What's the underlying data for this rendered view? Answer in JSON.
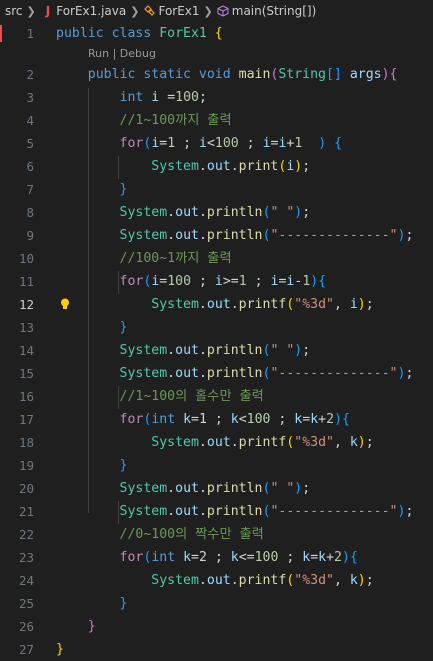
{
  "breadcrumb": {
    "items": [
      "src",
      "ForEx1.java",
      "ForEx1",
      "main(String[])"
    ],
    "java_icon": "J"
  },
  "codelens": "Run | Debug",
  "icons": {
    "chevron": "chevron-right-icon",
    "java_file": "java-file-icon",
    "class": "class-icon",
    "method": "method-icon",
    "lightbulb": "lightbulb-icon"
  },
  "colors": {
    "background": "#1f1f1f",
    "keyword": "#569cd6",
    "control": "#c586c0",
    "type": "#4ec9b0",
    "variable": "#9cdcfe",
    "function": "#dcdcaa",
    "number": "#b5cea8",
    "string": "#ce9178",
    "comment": "#6a9955",
    "bracket_gold": "#ffd700",
    "bracket_pink": "#da70d6",
    "bracket_blue": "#179fff"
  },
  "current_line": 12,
  "lines": [
    {
      "n": "1",
      "t": [
        [
          "kw",
          "public "
        ],
        [
          "kw",
          "class "
        ],
        [
          "type",
          "ForEx1 "
        ],
        [
          "br1",
          "{"
        ]
      ]
    },
    {
      "n": "2",
      "t": [
        [
          "",
          "    "
        ],
        [
          "kw",
          "public "
        ],
        [
          "kw",
          "static "
        ],
        [
          "kw",
          "void "
        ],
        [
          "fn",
          "main"
        ],
        [
          "br2",
          "("
        ],
        [
          "type",
          "String"
        ],
        [
          "br3",
          "[]"
        ],
        [
          "var",
          " args"
        ],
        [
          "br2",
          ")"
        ],
        [
          "br2",
          "{"
        ]
      ]
    },
    {
      "n": "3",
      "t": [
        [
          "",
          "        "
        ],
        [
          "kw",
          "int "
        ],
        [
          "var",
          "i"
        ],
        [
          "",
          " ="
        ],
        [
          "num",
          "100"
        ],
        [
          "",
          ";"
        ]
      ]
    },
    {
      "n": "4",
      "t": [
        [
          "",
          "        "
        ],
        [
          "cmt",
          "//1~100까지 출력"
        ]
      ]
    },
    {
      "n": "5",
      "t": [
        [
          "",
          "        "
        ],
        [
          "ctl",
          "for"
        ],
        [
          "br3",
          "("
        ],
        [
          "var",
          "i"
        ],
        [
          "",
          "="
        ],
        [
          "num",
          "1"
        ],
        [
          "",
          " ; "
        ],
        [
          "var",
          "i"
        ],
        [
          "",
          "<"
        ],
        [
          "num",
          "100"
        ],
        [
          "",
          " ; "
        ],
        [
          "var",
          "i"
        ],
        [
          "",
          "="
        ],
        [
          "var",
          "i"
        ],
        [
          "",
          "+"
        ],
        [
          "num",
          "1"
        ],
        [
          "",
          "  "
        ],
        [
          "br3",
          ")"
        ],
        [
          "",
          " "
        ],
        [
          "br3",
          "{"
        ]
      ]
    },
    {
      "n": "6",
      "t": [
        [
          "",
          "            "
        ],
        [
          "type",
          "System"
        ],
        [
          "",
          "."
        ],
        [
          "var",
          "out"
        ],
        [
          "",
          "."
        ],
        [
          "fn",
          "print"
        ],
        [
          "br1",
          "("
        ],
        [
          "var",
          "i"
        ],
        [
          "br1",
          ")"
        ],
        [
          "",
          ";"
        ]
      ]
    },
    {
      "n": "7",
      "t": [
        [
          "",
          "        "
        ],
        [
          "br3",
          "}"
        ]
      ]
    },
    {
      "n": "8",
      "t": [
        [
          "",
          "        "
        ],
        [
          "type",
          "System"
        ],
        [
          "",
          "."
        ],
        [
          "var",
          "out"
        ],
        [
          "",
          "."
        ],
        [
          "fn",
          "println"
        ],
        [
          "br3",
          "("
        ],
        [
          "str",
          "\" \""
        ],
        [
          "br3",
          ")"
        ],
        [
          "",
          ";"
        ]
      ]
    },
    {
      "n": "9",
      "t": [
        [
          "",
          "        "
        ],
        [
          "type",
          "System"
        ],
        [
          "",
          "."
        ],
        [
          "var",
          "out"
        ],
        [
          "",
          "."
        ],
        [
          "fn",
          "println"
        ],
        [
          "br3",
          "("
        ],
        [
          "str",
          "\"--------------\""
        ],
        [
          "br3",
          ")"
        ],
        [
          "",
          ";"
        ]
      ]
    },
    {
      "n": "10",
      "t": [
        [
          "",
          "        "
        ],
        [
          "cmt",
          "//100~1까지 출력"
        ]
      ]
    },
    {
      "n": "11",
      "t": [
        [
          "",
          "        "
        ],
        [
          "ctl",
          "for"
        ],
        [
          "br3",
          "("
        ],
        [
          "var",
          "i"
        ],
        [
          "",
          "="
        ],
        [
          "num",
          "100"
        ],
        [
          "",
          " ; "
        ],
        [
          "var",
          "i"
        ],
        [
          "",
          ">="
        ],
        [
          "num",
          "1"
        ],
        [
          "",
          " ; "
        ],
        [
          "var",
          "i"
        ],
        [
          "",
          "="
        ],
        [
          "var",
          "i"
        ],
        [
          "",
          "-"
        ],
        [
          "num",
          "1"
        ],
        [
          "br3",
          ")"
        ],
        [
          "br3",
          "{"
        ]
      ]
    },
    {
      "n": "12",
      "t": [
        [
          "",
          "            "
        ],
        [
          "type",
          "System"
        ],
        [
          "",
          "."
        ],
        [
          "var",
          "out"
        ],
        [
          "",
          "."
        ],
        [
          "fn",
          "printf"
        ],
        [
          "br1",
          "("
        ],
        [
          "str",
          "\"%3d\""
        ],
        [
          "",
          ", "
        ],
        [
          "var",
          "i"
        ],
        [
          "br1",
          ")"
        ],
        [
          "",
          ";"
        ]
      ]
    },
    {
      "n": "13",
      "t": [
        [
          "",
          "        "
        ],
        [
          "br3",
          "}"
        ]
      ]
    },
    {
      "n": "14",
      "t": [
        [
          "",
          "        "
        ],
        [
          "type",
          "System"
        ],
        [
          "",
          "."
        ],
        [
          "var",
          "out"
        ],
        [
          "",
          "."
        ],
        [
          "fn",
          "println"
        ],
        [
          "br3",
          "("
        ],
        [
          "str",
          "\" \""
        ],
        [
          "br3",
          ")"
        ],
        [
          "",
          ";"
        ]
      ]
    },
    {
      "n": "15",
      "t": [
        [
          "",
          "        "
        ],
        [
          "type",
          "System"
        ],
        [
          "",
          "."
        ],
        [
          "var",
          "out"
        ],
        [
          "",
          "."
        ],
        [
          "fn",
          "println"
        ],
        [
          "br3",
          "("
        ],
        [
          "str",
          "\"--------------\""
        ],
        [
          "br3",
          ")"
        ],
        [
          "",
          ";"
        ]
      ]
    },
    {
      "n": "16",
      "t": [
        [
          "",
          "        "
        ],
        [
          "cmt",
          "//1~100의 홀수만 출력"
        ]
      ]
    },
    {
      "n": "17",
      "t": [
        [
          "",
          "        "
        ],
        [
          "ctl",
          "for"
        ],
        [
          "br3",
          "("
        ],
        [
          "kw",
          "int "
        ],
        [
          "var",
          "k"
        ],
        [
          "",
          "=1 ; "
        ],
        [
          "var",
          "k"
        ],
        [
          "",
          "<"
        ],
        [
          "num",
          "100"
        ],
        [
          "",
          " ; "
        ],
        [
          "var",
          "k"
        ],
        [
          "",
          "="
        ],
        [
          "var",
          "k"
        ],
        [
          "",
          "+"
        ],
        [
          "num",
          "2"
        ],
        [
          "br3",
          ")"
        ],
        [
          "br3",
          "{"
        ]
      ]
    },
    {
      "n": "18",
      "t": [
        [
          "",
          "            "
        ],
        [
          "type",
          "System"
        ],
        [
          "",
          "."
        ],
        [
          "var",
          "out"
        ],
        [
          "",
          "."
        ],
        [
          "fn",
          "printf"
        ],
        [
          "br1",
          "("
        ],
        [
          "str",
          "\"%3d\""
        ],
        [
          "",
          ", "
        ],
        [
          "var",
          "k"
        ],
        [
          "br1",
          ")"
        ],
        [
          "",
          ";"
        ]
      ]
    },
    {
      "n": "19",
      "t": [
        [
          "",
          "        "
        ],
        [
          "br3",
          "}"
        ]
      ]
    },
    {
      "n": "20",
      "t": [
        [
          "",
          "        "
        ],
        [
          "type",
          "System"
        ],
        [
          "",
          "."
        ],
        [
          "var",
          "out"
        ],
        [
          "",
          "."
        ],
        [
          "fn",
          "println"
        ],
        [
          "br3",
          "("
        ],
        [
          "str",
          "\" \""
        ],
        [
          "br3",
          ")"
        ],
        [
          "",
          ";"
        ]
      ]
    },
    {
      "n": "21",
      "t": [
        [
          "",
          "        "
        ],
        [
          "type",
          "System"
        ],
        [
          "",
          "."
        ],
        [
          "var",
          "out"
        ],
        [
          "",
          "."
        ],
        [
          "fn",
          "println"
        ],
        [
          "br3",
          "("
        ],
        [
          "str",
          "\"--------------\""
        ],
        [
          "br3",
          ")"
        ],
        [
          "",
          ";"
        ]
      ]
    },
    {
      "n": "22",
      "t": [
        [
          "",
          "        "
        ],
        [
          "cmt",
          "//0~100의 짝수만 출력"
        ]
      ]
    },
    {
      "n": "23",
      "t": [
        [
          "",
          "        "
        ],
        [
          "ctl",
          "for"
        ],
        [
          "br3",
          "("
        ],
        [
          "kw",
          "int "
        ],
        [
          "var",
          "k"
        ],
        [
          "",
          "=2 ; "
        ],
        [
          "var",
          "k"
        ],
        [
          "",
          "<="
        ],
        [
          "num",
          "100"
        ],
        [
          "",
          " ; "
        ],
        [
          "var",
          "k"
        ],
        [
          "",
          "="
        ],
        [
          "var",
          "k"
        ],
        [
          "",
          "+"
        ],
        [
          "num",
          "2"
        ],
        [
          "br3",
          ")"
        ],
        [
          "br3",
          "{"
        ]
      ]
    },
    {
      "n": "24",
      "t": [
        [
          "",
          "            "
        ],
        [
          "type",
          "System"
        ],
        [
          "",
          "."
        ],
        [
          "var",
          "out"
        ],
        [
          "",
          "."
        ],
        [
          "fn",
          "printf"
        ],
        [
          "br1",
          "("
        ],
        [
          "str",
          "\"%3d\""
        ],
        [
          "",
          ", "
        ],
        [
          "var",
          "k"
        ],
        [
          "br1",
          ")"
        ],
        [
          "",
          ";"
        ]
      ]
    },
    {
      "n": "25",
      "t": [
        [
          "",
          "        "
        ],
        [
          "br3",
          "}"
        ]
      ]
    },
    {
      "n": "26",
      "t": [
        [
          "",
          "    "
        ],
        [
          "br2",
          "}"
        ]
      ]
    },
    {
      "n": "27",
      "t": [
        [
          "br1",
          "}"
        ]
      ]
    }
  ]
}
